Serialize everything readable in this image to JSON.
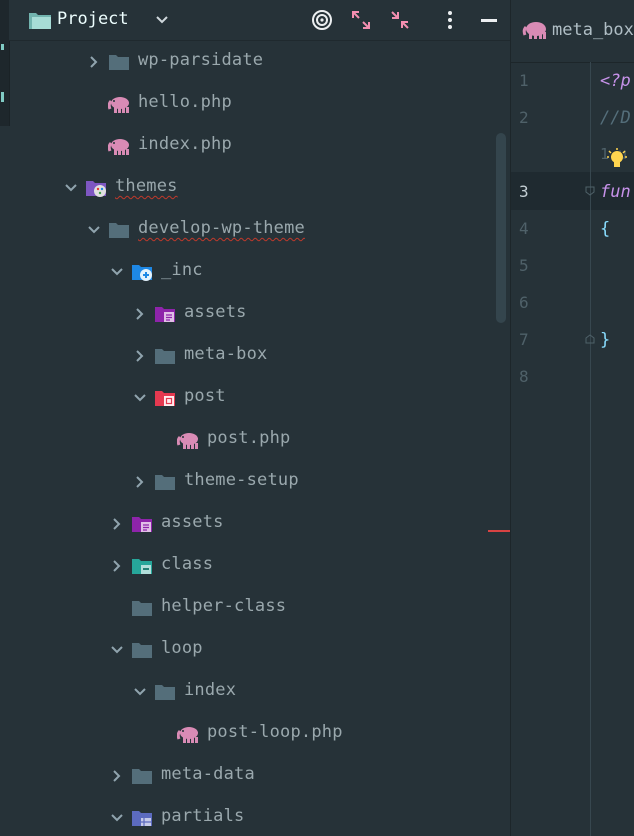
{
  "header": {
    "title": "Project"
  },
  "tree": [
    {
      "label": "wp-parsidate",
      "type": "folder",
      "expanded": false,
      "level": 3
    },
    {
      "label": "hello.php",
      "type": "php",
      "level": 3
    },
    {
      "label": "index.php",
      "type": "php",
      "level": 3
    },
    {
      "label": "themes",
      "type": "themes-folder",
      "expanded": true,
      "level": 2
    },
    {
      "label": "develop-wp-theme",
      "type": "folder",
      "expanded": true,
      "level": 3
    },
    {
      "label": "_inc",
      "type": "inc-folder",
      "expanded": true,
      "level": 4
    },
    {
      "label": "assets",
      "type": "assets-folder",
      "expanded": false,
      "level": 5
    },
    {
      "label": "meta-box",
      "type": "folder",
      "expanded": false,
      "level": 5
    },
    {
      "label": "post",
      "type": "post-folder",
      "expanded": true,
      "level": 5
    },
    {
      "label": "post.php",
      "type": "php",
      "level": 6
    },
    {
      "label": "theme-setup",
      "type": "folder",
      "expanded": false,
      "level": 5
    },
    {
      "label": "assets",
      "type": "assets-folder",
      "expanded": false,
      "level": 4
    },
    {
      "label": "class",
      "type": "class-folder",
      "expanded": false,
      "level": 4
    },
    {
      "label": "helper-class",
      "type": "folder",
      "level": 4
    },
    {
      "label": "loop",
      "type": "folder",
      "expanded": true,
      "level": 4
    },
    {
      "label": "index",
      "type": "folder",
      "expanded": true,
      "level": 5
    },
    {
      "label": "post-loop.php",
      "type": "php",
      "level": 6
    },
    {
      "label": "meta-data",
      "type": "folder",
      "expanded": false,
      "level": 4
    },
    {
      "label": "partials",
      "type": "partials-folder",
      "expanded": true,
      "level": 4
    }
  ],
  "editor": {
    "tab_label": "meta_box",
    "line_numbers": [
      "1",
      "2",
      "",
      "3",
      "4",
      "5",
      "6",
      "7",
      "8"
    ],
    "code": {
      "l1": "<?p",
      "l2": "//D",
      "l_usage": "1 u",
      "l3": "fun",
      "l4": "{",
      "l7": "}"
    }
  },
  "colors": {
    "background": "#263238",
    "text": "#9aa8ad",
    "folder": "#546e7a",
    "php": "#d98bb5",
    "keyword": "#c792ea",
    "comment": "#546e7a"
  }
}
